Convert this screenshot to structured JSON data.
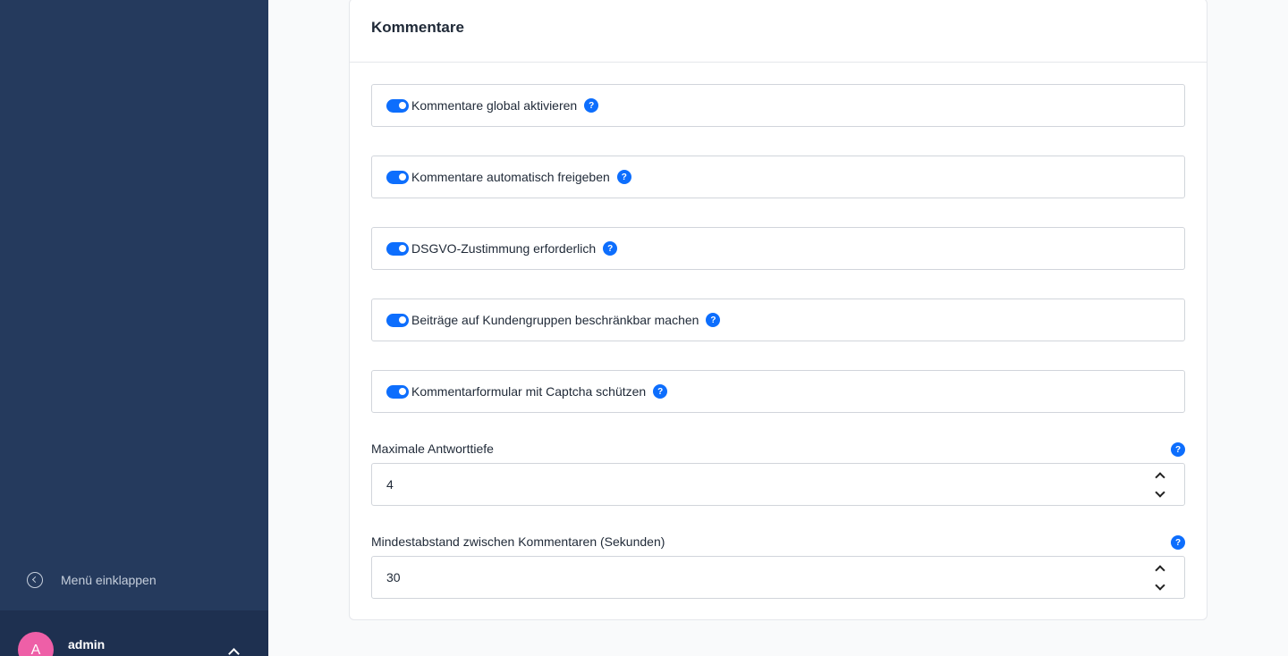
{
  "sidebar": {
    "collapse_label": "Menü einklappen",
    "user": {
      "initial": "A",
      "name": "admin"
    }
  },
  "card": {
    "title": "Kommentare",
    "toggles": [
      {
        "label": "Kommentare global aktivieren",
        "enabled": true
      },
      {
        "label": "Kommentare automatisch freigeben",
        "enabled": true
      },
      {
        "label": "DSGVO-Zustimmung erforderlich",
        "enabled": true
      },
      {
        "label": "Beiträge auf Kundengruppen beschränkbar machen",
        "enabled": true
      },
      {
        "label": "Kommentarformular mit Captcha schützen",
        "enabled": true
      }
    ],
    "fields": [
      {
        "label": "Maximale Antworttiefe",
        "value": "4"
      },
      {
        "label": "Mindestabstand zwischen Kommentaren (Sekunden)",
        "value": "30"
      }
    ],
    "help_glyph": "?"
  },
  "colors": {
    "sidebar": "#253a5d",
    "accent": "#0d6efd",
    "avatar": "#ee5fa7"
  }
}
